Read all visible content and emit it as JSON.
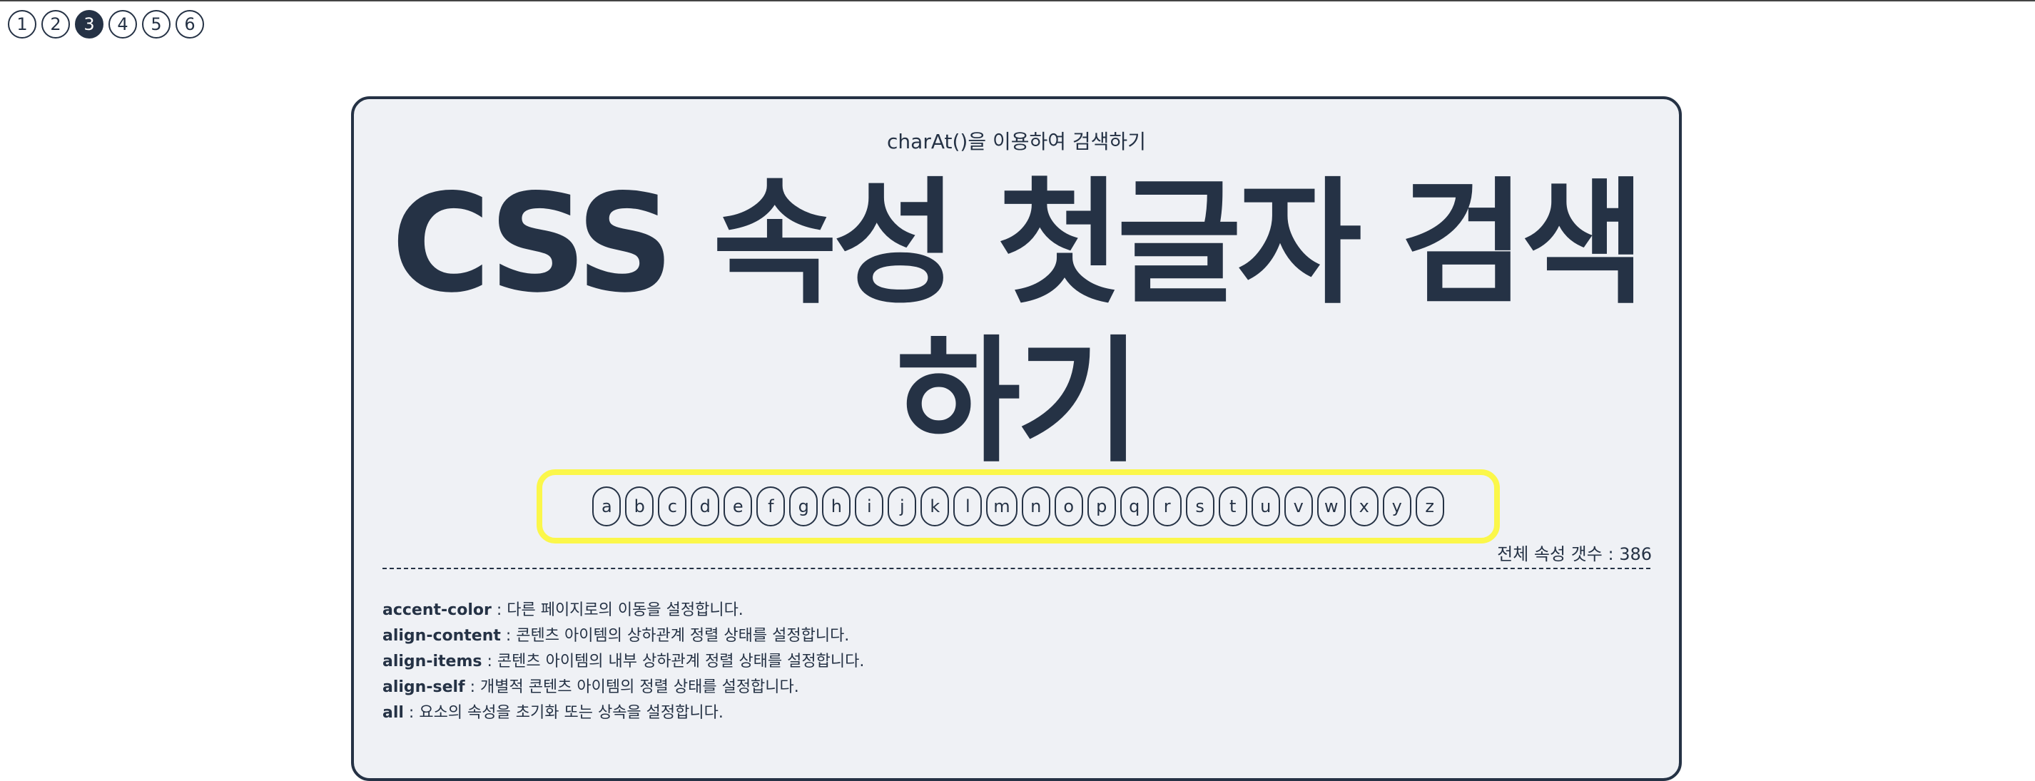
{
  "pager": {
    "pages": [
      "1",
      "2",
      "3",
      "4",
      "5",
      "6"
    ],
    "active_index": 2
  },
  "header": {
    "subtitle": "charAt()을 이용하여 검색하기",
    "title": "CSS 속성 첫글자 검색하기"
  },
  "alphabet": [
    "a",
    "b",
    "c",
    "d",
    "e",
    "f",
    "g",
    "h",
    "i",
    "j",
    "k",
    "l",
    "m",
    "n",
    "o",
    "p",
    "q",
    "r",
    "s",
    "t",
    "u",
    "v",
    "w",
    "x",
    "y",
    "z"
  ],
  "count_text": "전체 속성 갯수 : 386",
  "properties": [
    {
      "name": "accent-color",
      "desc": " : 다른 페이지로의 이동을 설정합니다."
    },
    {
      "name": "align-content",
      "desc": " : 콘텐츠 아이템의 상하관계 정렬 상태를 설정합니다."
    },
    {
      "name": "align-items",
      "desc": " : 콘텐츠 아이템의 내부 상하관계 정렬 상태를 설정합니다."
    },
    {
      "name": "align-self",
      "desc": " : 개별적 콘텐츠 아이템의 정렬 상태를 설정합니다."
    },
    {
      "name": "all",
      "desc": " : 요소의 속성을 초기화 또는 상속을 설정합니다."
    }
  ],
  "colors": {
    "primary": "#253245",
    "card_background": "#eff1f5",
    "highlight": "#fbf74a"
  }
}
